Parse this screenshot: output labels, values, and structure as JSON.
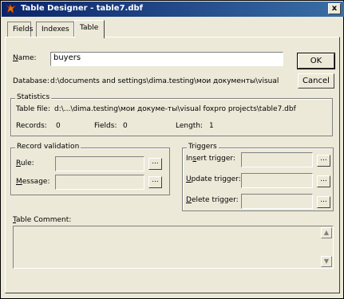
{
  "window": {
    "title": "Table Designer - table7.dbf",
    "close_label": "x"
  },
  "tabs": [
    {
      "label": "Fields",
      "active": false
    },
    {
      "label": "Indexes",
      "active": false
    },
    {
      "label": "Table",
      "active": true
    }
  ],
  "table": {
    "name_label": "Name:",
    "name_value": "buyers",
    "database_label": "Database:",
    "database_value": "d:\\documents and settings\\dima.testing\\мои документы\\visual"
  },
  "buttons": {
    "ok": "OK",
    "cancel": "Cancel",
    "ellipsis": "..."
  },
  "statistics": {
    "title": "Statistics",
    "table_file_label": "Table file:",
    "table_file_value": "d:\\...\\dima.testing\\мои докуме-ты\\visual foxpro projects\\table7.dbf",
    "records_label": "Records:",
    "records_value": "0",
    "fields_label": "Fields:",
    "fields_value": "0",
    "length_label": "Length:",
    "length_value": "1"
  },
  "record_validation": {
    "title": "Record validation",
    "rule_label": "Rule:",
    "message_label": "Message:"
  },
  "triggers": {
    "title": "Triggers",
    "insert_label": "Insert trigger:",
    "update_label": "Update trigger:",
    "delete_label": "Delete trigger:"
  },
  "comment": {
    "label": "Table Comment:"
  }
}
